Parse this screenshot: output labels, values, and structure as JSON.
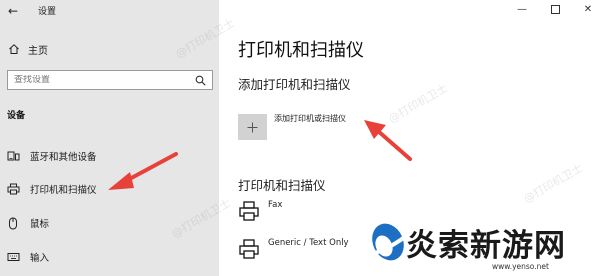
{
  "window": {
    "back_icon": "back-arrow-icon",
    "app_title": "设置",
    "controls": [
      "minimize-icon",
      "maximize-icon",
      "close-icon"
    ]
  },
  "sidebar": {
    "home_label": "主页",
    "home_icon": "home-icon",
    "search": {
      "placeholder": "查找设置",
      "icon": "search-icon"
    },
    "group_header": "设备",
    "items": [
      {
        "label": "蓝牙和其他设备",
        "icon": "bluetooth-devices-icon",
        "selected": false
      },
      {
        "label": "打印机和扫描仪",
        "icon": "printer-icon",
        "selected": true
      },
      {
        "label": "鼠标",
        "icon": "mouse-icon",
        "selected": false
      },
      {
        "label": "输入",
        "icon": "keyboard-icon",
        "selected": false
      }
    ]
  },
  "main": {
    "page_title": "打印机和扫描仪",
    "add_section": {
      "title": "添加打印机和扫描仪",
      "add_button_label": "添加打印机或扫描仪",
      "add_icon": "plus-icon"
    },
    "list_section": {
      "title": "打印机和扫描仪",
      "printers": [
        {
          "name": "Fax",
          "icon": "printer-icon"
        },
        {
          "name": "Generic / Text Only",
          "icon": "printer-icon"
        }
      ]
    }
  },
  "overlay": {
    "watermark_text": "@打印机卫士",
    "arrow_color": "#e8413a",
    "logo_text": "炎索新游网",
    "logo_url": "www.yenso.net"
  }
}
